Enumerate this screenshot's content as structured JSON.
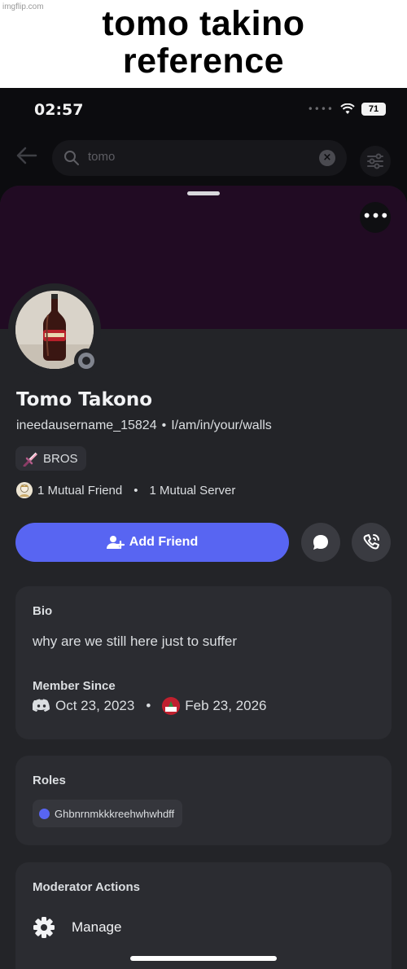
{
  "meme": {
    "watermark": "imgflip.com",
    "caption_line1": "tomo takino",
    "caption_line2": "reference"
  },
  "status_bar": {
    "time": "02:57",
    "battery": "71"
  },
  "search": {
    "query": "tomo",
    "icons": [
      "back-arrow-icon",
      "search-icon",
      "clear-icon",
      "filter-icon"
    ]
  },
  "profile": {
    "display_name": "Tomo Takono",
    "username": "ineedausername_15824",
    "separator": "•",
    "pronouns": "I/am/in/your/walls",
    "tag": {
      "label": "BROS",
      "icon": "sword-icon"
    },
    "mutual_friends": "1 Mutual Friend",
    "mutual_separator": "•",
    "mutual_servers": "1 Mutual Server",
    "status": "offline",
    "banner_color": "#210b23",
    "accent_color": "#5865f2"
  },
  "actions": {
    "add_friend_label": "Add Friend",
    "message_icon": "chat-bubble-icon",
    "call_icon": "phone-call-icon",
    "more_label": "•••"
  },
  "bio": {
    "title": "Bio",
    "text": "why are we still here just to suffer"
  },
  "member_since": {
    "title": "Member Since",
    "discord_date": "Oct 23, 2023",
    "separator": "•",
    "server_date": "Feb 23, 2026"
  },
  "roles": {
    "title": "Roles",
    "items": [
      {
        "label": "Ghbnrnmkkkreehwhwhdff",
        "color": "#5865f2"
      }
    ]
  },
  "moderator": {
    "title": "Moderator Actions",
    "manage_label": "Manage"
  }
}
